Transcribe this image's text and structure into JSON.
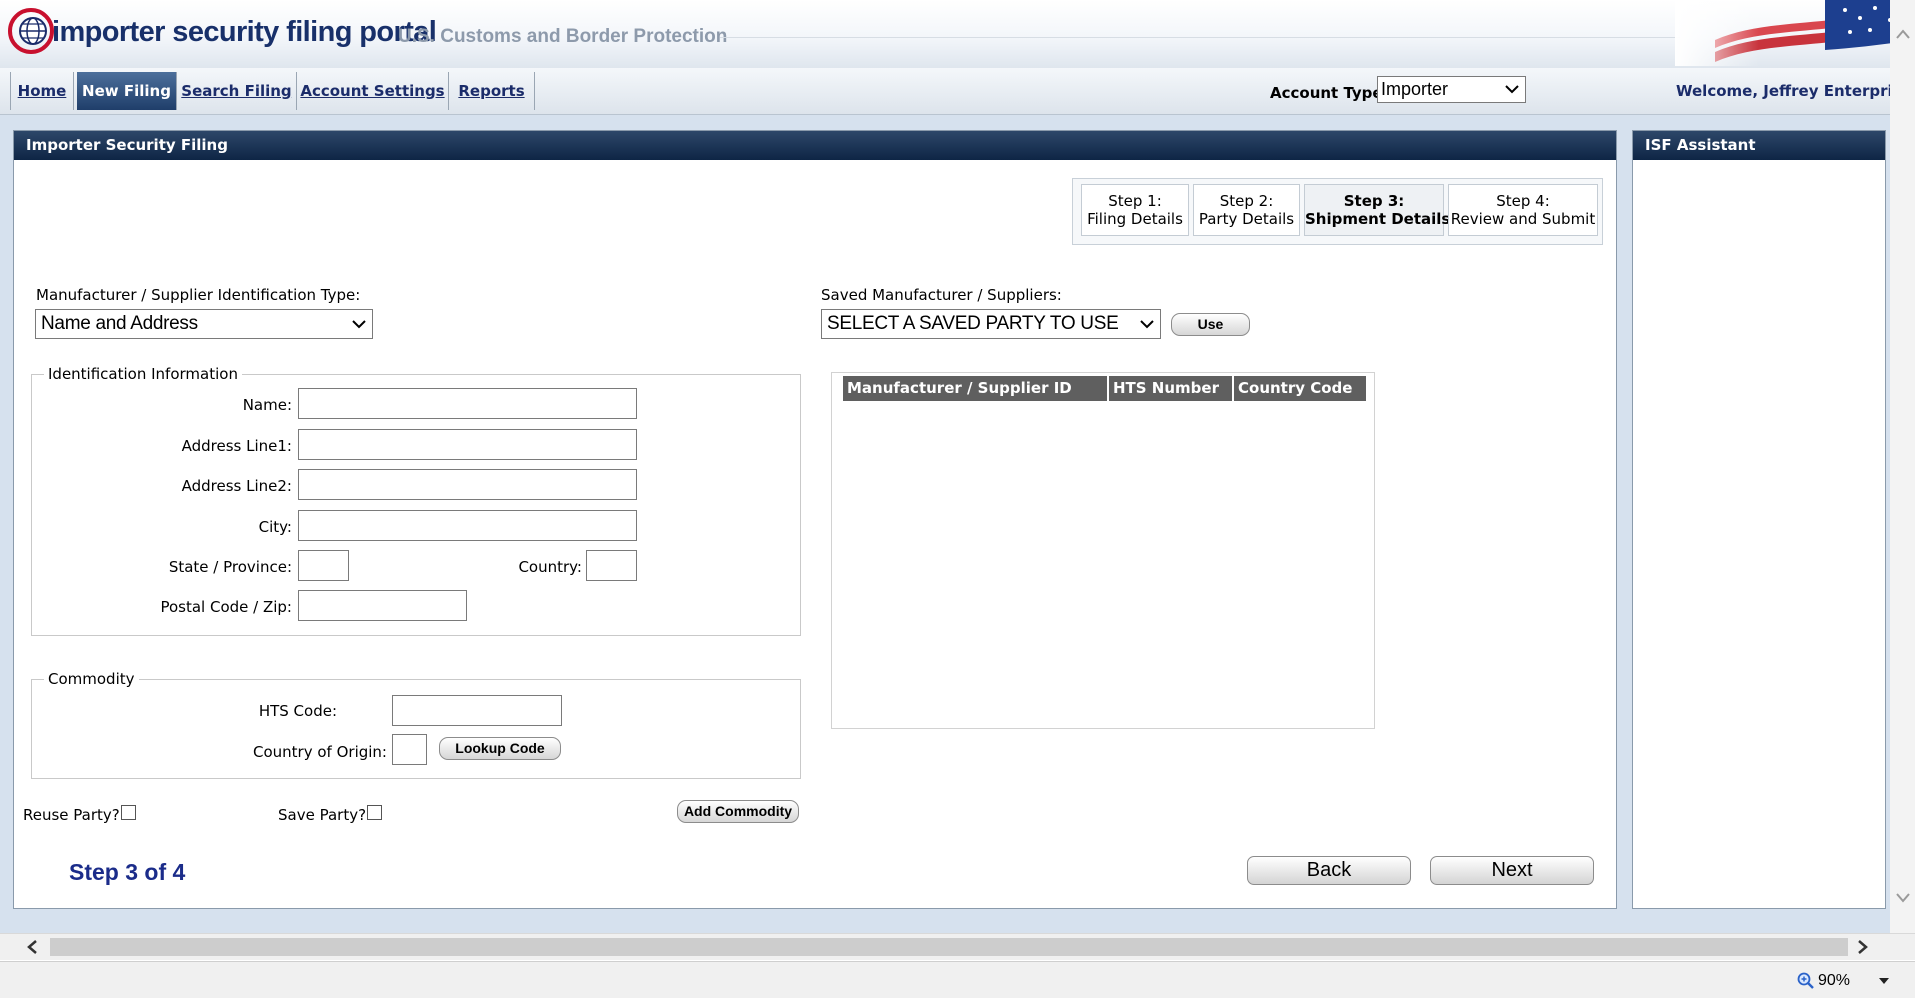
{
  "header": {
    "title": "importer security filing portal",
    "subtitle": "U.S. Customs and Border Protection"
  },
  "nav": {
    "tabs": [
      {
        "label": "Home",
        "active": false
      },
      {
        "label": "New Filing",
        "active": true
      },
      {
        "label": "Search Filing",
        "active": false
      },
      {
        "label": "Account Settings",
        "active": false
      },
      {
        "label": "Reports",
        "active": false
      }
    ],
    "account_type_label": "Account Type:",
    "account_type_value": "Importer",
    "welcome": "Welcome, Jeffrey Enterprise"
  },
  "main": {
    "title": "Importer Security Filing",
    "steps": [
      {
        "line1": "Step 1:",
        "line2": "Filing Details",
        "current": false
      },
      {
        "line1": "Step 2:",
        "line2": "Party Details",
        "current": false
      },
      {
        "line1": "Step 3:",
        "line2": "Shipment Details",
        "current": true
      },
      {
        "line1": "Step 4:",
        "line2": "Review and Submit",
        "current": false
      }
    ],
    "id_type_label": "Manufacturer / Supplier Identification Type:",
    "id_type_value": "Name and Address",
    "saved_label": "Saved Manufacturer / Suppliers:",
    "saved_value": "SELECT A SAVED PARTY TO USE",
    "use_button": "Use",
    "identification": {
      "legend": "Identification Information",
      "name_label": "Name:",
      "address1_label": "Address Line1:",
      "address2_label": "Address Line2:",
      "city_label": "City:",
      "state_label": "State / Province:",
      "country_label": "Country:",
      "postal_label": "Postal Code / Zip:"
    },
    "commodity": {
      "legend": "Commodity",
      "hts_label": "HTS Code:",
      "origin_label": "Country of Origin:",
      "lookup_button": "Lookup Code"
    },
    "reuse_party_label": "Reuse Party?",
    "save_party_label": "Save Party?",
    "add_commodity_button": "Add Commodity",
    "grid_columns": [
      "Manufacturer / Supplier ID",
      "HTS Number",
      "Country Code"
    ],
    "step_counter": "Step 3 of 4",
    "back_button": "Back",
    "next_button": "Next"
  },
  "assistant": {
    "title": "ISF Assistant"
  },
  "status": {
    "zoom": "90%"
  },
  "colors": {
    "nav_active": "#1f3e6a",
    "panel_title": "#0e2545",
    "link": "#1b2c6a"
  }
}
